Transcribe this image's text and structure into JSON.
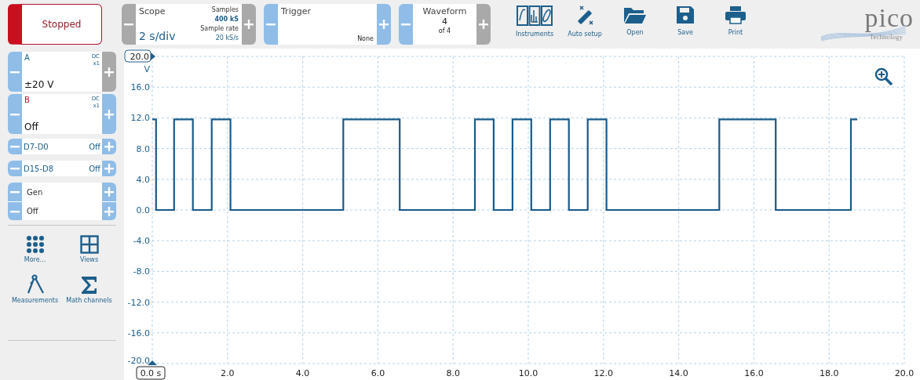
{
  "run_button": {
    "label": "Stopped",
    "running": false
  },
  "scope": {
    "title": "Scope",
    "timebase": "2 s/div",
    "samples_label": "Samples",
    "samples": "400 kS",
    "rate_label": "Sample rate",
    "rate": "20 kS/s",
    "minus_disabled": true,
    "plus_disabled": true
  },
  "trigger": {
    "title": "Trigger",
    "mode": "None",
    "minus_disabled": false,
    "plus_disabled": false
  },
  "waveform": {
    "title": "Waveform",
    "index": "4",
    "count": "of 4",
    "minus_disabled": false,
    "plus_disabled": true
  },
  "toolbar": [
    {
      "kind": "instruments",
      "label": "Instruments"
    },
    {
      "kind": "autosetup",
      "label": "Auto setup"
    },
    {
      "kind": "open",
      "label": "Open"
    },
    {
      "kind": "save",
      "label": "Save"
    },
    {
      "kind": "print",
      "label": "Print"
    }
  ],
  "logo": {
    "name": "pico",
    "tagline": "Technology"
  },
  "channels": [
    {
      "kind": "analog",
      "name": "A",
      "color": "#1d5f8c",
      "coupling": "DC",
      "probe": "x1",
      "range": "±20 V",
      "minus_disabled": false,
      "plus_disabled": true
    },
    {
      "kind": "analog",
      "name": "B",
      "color": "#b3142e",
      "coupling": "DC",
      "probe": "x1",
      "range": "Off",
      "minus_disabled": false,
      "plus_disabled": false
    },
    {
      "kind": "digital",
      "name": "D7-D0",
      "state": "Off",
      "minus_disabled": false,
      "plus_disabled": false
    },
    {
      "kind": "digital",
      "name": "D15-D8",
      "state": "Off",
      "minus_disabled": false,
      "plus_disabled": false
    }
  ],
  "generator": {
    "rows": [
      {
        "label": "Gen",
        "minus_disabled": false,
        "plus_disabled": false
      },
      {
        "label": "Off",
        "minus_disabled": false,
        "plus_disabled": false
      }
    ]
  },
  "tools": [
    {
      "kind": "more",
      "label": "More..."
    },
    {
      "kind": "views",
      "label": "Views"
    },
    {
      "kind": "measurements",
      "label": "Measurements"
    },
    {
      "kind": "math",
      "label": "Math channels"
    }
  ],
  "scope_view": {
    "chart_data": {
      "type": "line",
      "grid": true,
      "ylabel": "V",
      "xlim": [
        0,
        20
      ],
      "ylim": [
        -20,
        20
      ],
      "xticks": [
        {
          "value": 0,
          "label": "0.0 s"
        },
        {
          "value": 2,
          "label": "2.0"
        },
        {
          "value": 4,
          "label": "4.0"
        },
        {
          "value": 6,
          "label": "6.0"
        },
        {
          "value": 8,
          "label": "8.0"
        },
        {
          "value": 10,
          "label": "10.0"
        },
        {
          "value": 12,
          "label": "12.0"
        },
        {
          "value": 14,
          "label": "14.0"
        },
        {
          "value": 16,
          "label": "16.0"
        },
        {
          "value": 18,
          "label": "18.0"
        },
        {
          "value": 20,
          "label": "20.0"
        }
      ],
      "yticks": [
        {
          "value": 20,
          "label": "20.0"
        },
        {
          "value": 16,
          "label": "16.0"
        },
        {
          "value": 12,
          "label": "12.0"
        },
        {
          "value": 8,
          "label": "8.0"
        },
        {
          "value": 4,
          "label": "4.0"
        },
        {
          "value": 0,
          "label": "0.0"
        },
        {
          "value": -4,
          "label": "-4.0"
        },
        {
          "value": -8,
          "label": "-8.0"
        },
        {
          "value": -12,
          "label": "-12.0"
        },
        {
          "value": -16,
          "label": "-16.0"
        },
        {
          "value": -20,
          "label": "-20.0"
        }
      ],
      "x": [
        0,
        0.1,
        0.1,
        0.58,
        0.58,
        1.08,
        1.08,
        1.58,
        1.58,
        2.08,
        2.08,
        5.08,
        5.08,
        6.58,
        6.58,
        8.58,
        8.58,
        9.08,
        9.08,
        9.58,
        9.58,
        10.08,
        10.08,
        10.58,
        10.58,
        11.08,
        11.08,
        11.58,
        11.58,
        12.08,
        12.08,
        15.08,
        15.08,
        16.58,
        16.58,
        18.58,
        18.58,
        18.75
      ],
      "series": [
        {
          "color": "#1a5a8a",
          "values": [
            11.8,
            11.8,
            0,
            0,
            11.8,
            11.8,
            0,
            0,
            11.8,
            11.8,
            0,
            0,
            11.8,
            11.8,
            0,
            0,
            11.8,
            11.8,
            0,
            0,
            11.8,
            11.8,
            0,
            0,
            11.8,
            11.8,
            0,
            0,
            11.8,
            11.8,
            0,
            0,
            11.8,
            11.8,
            0,
            0,
            11.8,
            11.8
          ]
        }
      ]
    }
  }
}
